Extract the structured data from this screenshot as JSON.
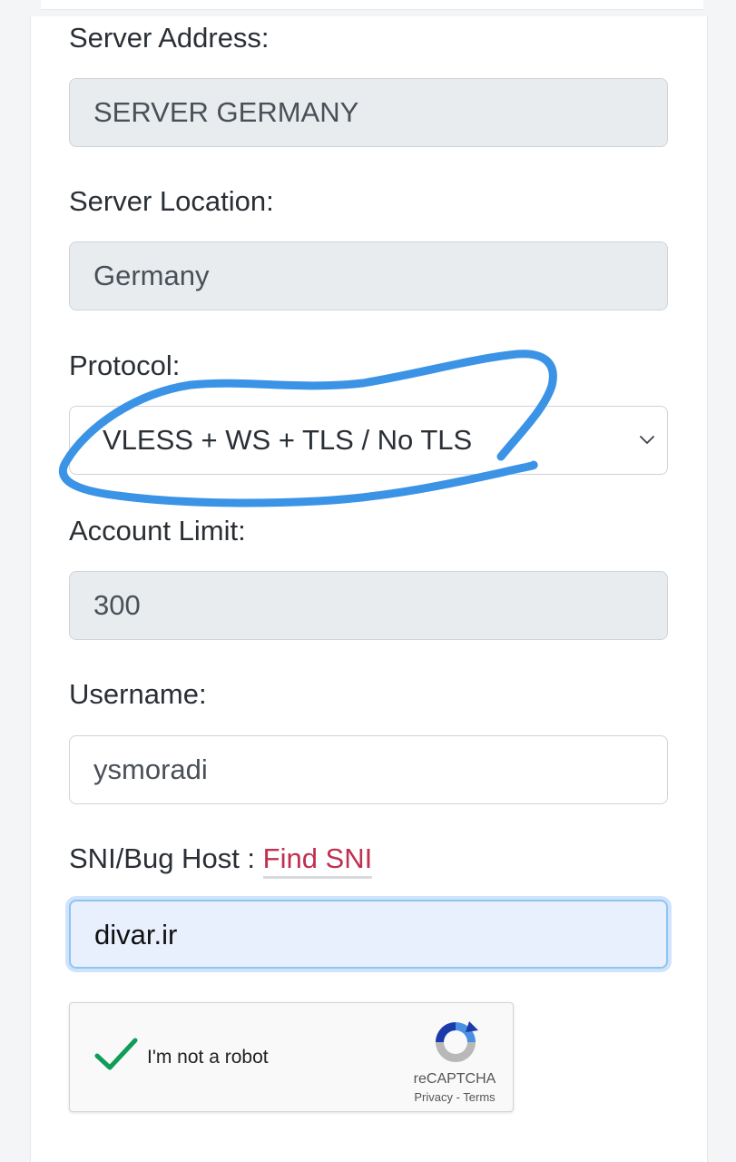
{
  "form": {
    "server_address": {
      "label": "Server Address:",
      "value": "SERVER GERMANY"
    },
    "server_location": {
      "label": "Server Location:",
      "value": "Germany"
    },
    "protocol": {
      "label": "Protocol:",
      "selected": "VLESS + WS + TLS / No TLS"
    },
    "account_limit": {
      "label": "Account Limit:",
      "value": "300"
    },
    "username": {
      "label": "Username:",
      "value": "ysmoradi"
    },
    "sni": {
      "label": "SNI/Bug Host : ",
      "link": "Find SNI",
      "value": "divar.ir"
    }
  },
  "captcha": {
    "label": "I'm not a robot",
    "brand": "reCAPTCHA",
    "privacy": "Privacy",
    "separator": " - ",
    "terms": "Terms",
    "checked": true
  },
  "colors": {
    "annotation": "#3b93e6",
    "link": "#c0304f",
    "check": "#0f9d58"
  }
}
